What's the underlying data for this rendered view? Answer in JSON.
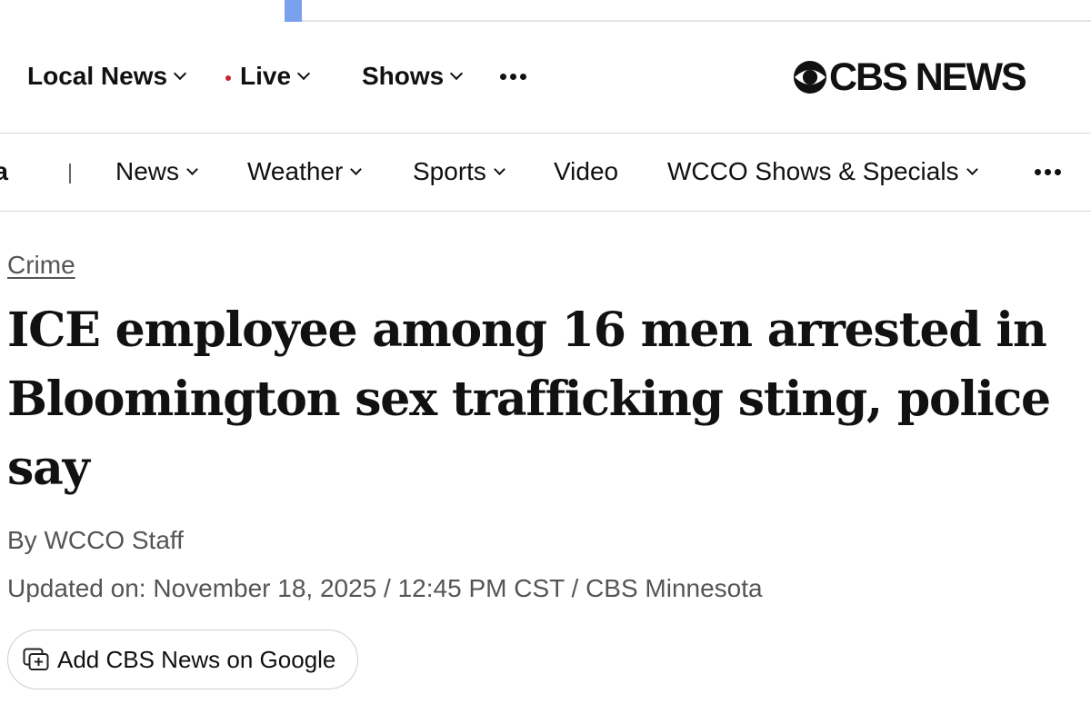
{
  "primary_nav": {
    "items": [
      {
        "label": "Local News"
      },
      {
        "label": "Live"
      },
      {
        "label": "Shows"
      }
    ],
    "more_icon": "more-dots-icon"
  },
  "logo": {
    "text": "CBS NEWS",
    "icon": "cbs-eye-icon"
  },
  "secondary_nav": {
    "region_fragment": "ta",
    "items": [
      {
        "label": "News"
      },
      {
        "label": "Weather"
      },
      {
        "label": "Sports"
      },
      {
        "label": "Video"
      },
      {
        "label": "WCCO Shows & Specials"
      }
    ],
    "more_icon": "more-dots-icon"
  },
  "article": {
    "category": "Crime",
    "headline": "ICE employee among 16 men arrested in Bloomington sex trafficking sting, police say",
    "byline": "By WCCO Staff",
    "updated": "Updated on: November 18, 2025 / 12:45 PM CST / CBS Minnesota"
  },
  "google_button": {
    "label": "Add CBS News on Google",
    "icon": "add-source-icon"
  },
  "colors": {
    "live_dot": "#c9232b",
    "text": "#111111",
    "muted_text": "#555555",
    "divider": "#d8d8d8"
  }
}
